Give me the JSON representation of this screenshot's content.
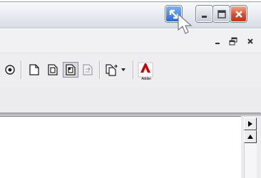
{
  "titlebar": {
    "caption_buttons": [
      {
        "name": "help-icon",
        "color": "#2767d9"
      },
      {
        "name": "minimize-icon"
      },
      {
        "name": "maximize-icon"
      },
      {
        "name": "close-icon",
        "color": "#d9492b"
      }
    ]
  },
  "menu_row": {
    "mdi_controls": [
      "minimize-icon",
      "restore-icon",
      "close-icon"
    ]
  },
  "toolbar": {
    "buttons": [
      {
        "name": "record-icon"
      },
      {
        "name": "page-icon"
      },
      {
        "name": "page-frame-icon"
      },
      {
        "name": "page-corner-icon",
        "pressed": true
      },
      {
        "name": "page-export-icon",
        "disabled": true
      },
      {
        "name": "page-dropdown-icon"
      },
      {
        "name": "chevron-down-icon"
      },
      {
        "name": "adobe-icon"
      }
    ],
    "adobe_label": "Adobe",
    "adobe_color": "#cc0000"
  },
  "scrollbar": {
    "icons": [
      "triangle-right-icon",
      "triangle-up-icon"
    ]
  }
}
